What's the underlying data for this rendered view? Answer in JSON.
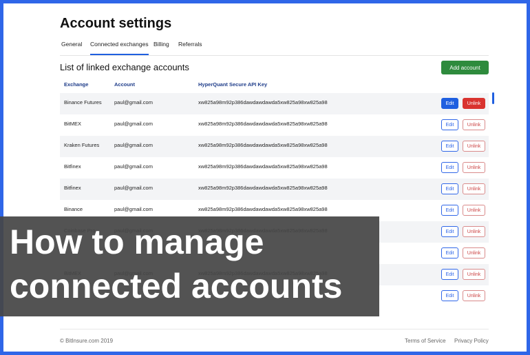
{
  "page": {
    "title": "Account settings",
    "tabs": [
      {
        "label": "General",
        "active": false
      },
      {
        "label": "Connected exchanges",
        "active": true
      },
      {
        "label": "Billing",
        "active": false
      },
      {
        "label": "Referrals",
        "active": false
      }
    ],
    "section_title": "List of linked exchange accounts",
    "add_button": "Add account"
  },
  "table": {
    "headers": [
      "Exchange",
      "Account",
      "HyperQuant Secure API  Key"
    ],
    "edit_label": "Edit",
    "unlink_label": "Unlink",
    "rows": [
      {
        "exchange": "Binance Futures",
        "account": "paul@gmail.com",
        "key": "xw825a98m92p386dawdawdawda5xw825a98xw825a98",
        "selected": true
      },
      {
        "exchange": "BitMEX",
        "account": "paul@gmail.com",
        "key": "xw825a98m92p386dawdawdawda5xw825a98xw825a98",
        "selected": false
      },
      {
        "exchange": "Kraken Futures",
        "account": "paul@gmail.com",
        "key": "xw825a98m92p386dawdawdawda5xw825a98xw825a98",
        "selected": false
      },
      {
        "exchange": "Bitfinex",
        "account": "paul@gmail.com",
        "key": "xw825a98m92p386dawdawdawda5xw825a98xw825a98",
        "selected": false
      },
      {
        "exchange": "Bitfinex",
        "account": "paul@gmail.com",
        "key": "xw825a98m92p386dawdawdawda5xw825a98xw825a98",
        "selected": false
      },
      {
        "exchange": "Binance",
        "account": "paul@gmail.com",
        "key": "xw825a98m92p386dawdawdawda5xw825a98xw825a98",
        "selected": false
      },
      {
        "exchange": "Coinbase Pro",
        "account": "paul@gmail.com",
        "key": "xw825a98m92p386dawdawdawda5xw825a98xw825a98",
        "selected": false
      },
      {
        "exchange": "",
        "account": "",
        "key": "",
        "selected": false
      },
      {
        "exchange": "BitMEX",
        "account": "paul@gmail.com",
        "key": "xw825a98m92p386dawdawdawda5xw825a98xw825a98",
        "selected": false
      },
      {
        "exchange": "",
        "account": "",
        "key": "",
        "selected": false
      }
    ]
  },
  "footer": {
    "copyright": "© BitInsure.com 2019",
    "terms": "Terms of Service",
    "privacy": "Privacy Policy"
  },
  "banner": {
    "line1": "How to manage",
    "line2": "connected accounts"
  },
  "colors": {
    "frame": "#2f66e8",
    "accent": "#1f5fe0",
    "add_button": "#2e8b3d",
    "unlink_active": "#d9332f"
  }
}
